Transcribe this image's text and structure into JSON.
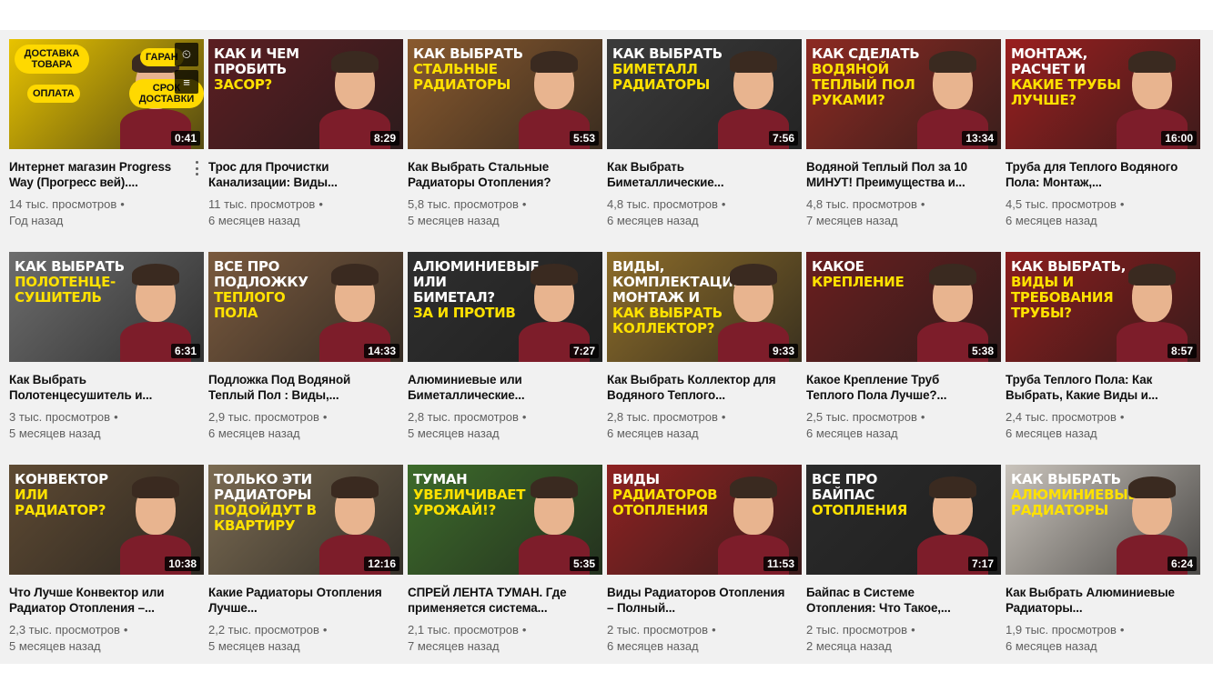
{
  "colors": {
    "highlight_text": "#ffe100",
    "panel_bg": "#f1f1f1",
    "meta_text": "#606060",
    "title_text": "#0f0f0f"
  },
  "icons": {
    "watch_later": "clock-icon",
    "add_to_queue": "queue-icon",
    "more": "more-vert-icon"
  },
  "videos": [
    {
      "caption_white": "",
      "caption_yellow": "",
      "badges": [
        "Доставка товара",
        "Гаран",
        "Оплата",
        "Срок доставки"
      ],
      "bg": "#e8c300",
      "duration": "0:41",
      "title": "Интернет магазин Progress Way (Прогресс вей)....",
      "views": "14 тыс. просмотров",
      "age": "Год назад"
    },
    {
      "caption_white": "Как и чем пробить",
      "caption_yellow": "засор?",
      "badges": [],
      "bg": "#5b1e22",
      "duration": "8:29",
      "title": "Трос для Прочистки Канализации: Виды...",
      "views": "11 тыс. просмотров",
      "age": "6 месяцев назад"
    },
    {
      "caption_white": "Как выбрать",
      "caption_yellow": "стальные радиаторы",
      "badges": [],
      "bg": "#8a5a2e",
      "duration": "5:53",
      "title": "Как Выбрать Стальные Радиаторы Отопления?",
      "views": "5,8 тыс. просмотров",
      "age": "5 месяцев назад"
    },
    {
      "caption_white": "Как выбрать",
      "caption_yellow": "биметалл радиаторы",
      "badges": [],
      "bg": "#3b3b3b",
      "duration": "7:56",
      "title": "Как Выбрать Биметаллические...",
      "views": "4,8 тыс. просмотров",
      "age": "6 месяцев назад"
    },
    {
      "caption_white": "Как сделать",
      "caption_yellow": "водяной теплый пол руками?",
      "badges": [],
      "bg": "#8d2a22",
      "duration": "13:34",
      "title": "Водяной Теплый Пол за 10 МИНУТ! Преимущества и...",
      "views": "4,8 тыс. просмотров",
      "age": "7 месяцев назад"
    },
    {
      "caption_white": "Монтаж, расчет и",
      "caption_yellow": "какие трубы лучше?",
      "badges": [],
      "bg": "#9a1f1f",
      "duration": "16:00",
      "title": "Труба для Теплого Водяного Пола: Монтаж,...",
      "views": "4,5 тыс. просмотров",
      "age": "6 месяцев назад"
    },
    {
      "caption_white": "Как выбрать",
      "caption_yellow": "полотенце-сушитель",
      "badges": [],
      "bg": "#6d6d6d",
      "duration": "6:31",
      "title": "Как Выбрать Полотенцесушитель и...",
      "views": "3 тыс. просмотров",
      "age": "5 месяцев назад"
    },
    {
      "caption_white": "Все про подложку",
      "caption_yellow": "теплого пола",
      "badges": [],
      "bg": "#7a5a3e",
      "duration": "14:33",
      "title": "Подложка Под Водяной Теплый Пол : Виды,...",
      "views": "2,9 тыс. просмотров",
      "age": "6 месяцев назад"
    },
    {
      "caption_white": "Алюминиевые или биметал?",
      "caption_yellow": "За и против",
      "badges": [],
      "bg": "#2f2f2f",
      "duration": "7:27",
      "title": "Алюминиевые или Биметаллические...",
      "views": "2,8 тыс. просмотров",
      "age": "5 месяцев назад"
    },
    {
      "caption_white": "Виды, комплектация, монтаж и",
      "caption_yellow": "как выбрать коллектор?",
      "badges": [],
      "bg": "#8c6c2a",
      "duration": "9:33",
      "title": "Как Выбрать Коллектор для Водяного Теплого...",
      "views": "2,8 тыс. просмотров",
      "age": "6 месяцев назад"
    },
    {
      "caption_white": "Какое",
      "caption_yellow": "крепление",
      "badges": [],
      "bg": "#6a1f1f",
      "duration": "5:38",
      "title": "Какое Крепление Труб Теплого Пола Лучше?...",
      "views": "2,5 тыс. просмотров",
      "age": "6 месяцев назад"
    },
    {
      "caption_white": "Как выбрать,",
      "caption_yellow": "виды и требования трубы?",
      "badges": [],
      "bg": "#8b1e1e",
      "duration": "8:57",
      "title": "Труба Теплого Пола: Как Выбрать, Какие Виды и...",
      "views": "2,4 тыс. просмотров",
      "age": "6 месяцев назад"
    },
    {
      "caption_white": "Конвектор",
      "caption_yellow": "или радиатор?",
      "badges": [],
      "bg": "#5e4a33",
      "duration": "10:38",
      "title": "Что Лучше Конвектор или Радиатор Отопления –...",
      "views": "2,3 тыс. просмотров",
      "age": "5 месяцев назад"
    },
    {
      "caption_white": "Только эти радиаторы",
      "caption_yellow": "подойдут в квартиру",
      "badges": [],
      "bg": "#7b6b52",
      "duration": "12:16",
      "title": "Какие Радиаторы Отопления Лучше...",
      "views": "2,2 тыс. просмотров",
      "age": "5 месяцев назад"
    },
    {
      "caption_white": "Туман",
      "caption_yellow": "увеличивает урожай!?",
      "badges": [],
      "bg": "#3d6b2b",
      "duration": "5:35",
      "title": "СПРЕЙ ЛЕНТА ТУМАН. Где применяется система...",
      "views": "2,1 тыс. просмотров",
      "age": "7 месяцев назад"
    },
    {
      "caption_white": "Виды",
      "caption_yellow": "радиаторов отопления",
      "badges": [],
      "bg": "#8e2222",
      "duration": "11:53",
      "title": "Виды Радиаторов Отопления – Полный...",
      "views": "2 тыс. просмотров",
      "age": "6 месяцев назад"
    },
    {
      "caption_white": "Все про байпас",
      "caption_yellow": "отопления",
      "badges": [],
      "bg": "#2b2b2b",
      "duration": "7:17",
      "title": "Байпас в Системе Отопления: Что Такое,...",
      "views": "2 тыс. просмотров",
      "age": "2 месяца назад"
    },
    {
      "caption_white": "Как выбрать",
      "caption_yellow": "алюминиевые радиаторы",
      "badges": [],
      "bg": "#c9c3bb",
      "duration": "6:24",
      "title": "Как Выбрать Алюминиевые Радиаторы...",
      "views": "1,9 тыс. просмотров",
      "age": "6 месяцев назад"
    }
  ]
}
